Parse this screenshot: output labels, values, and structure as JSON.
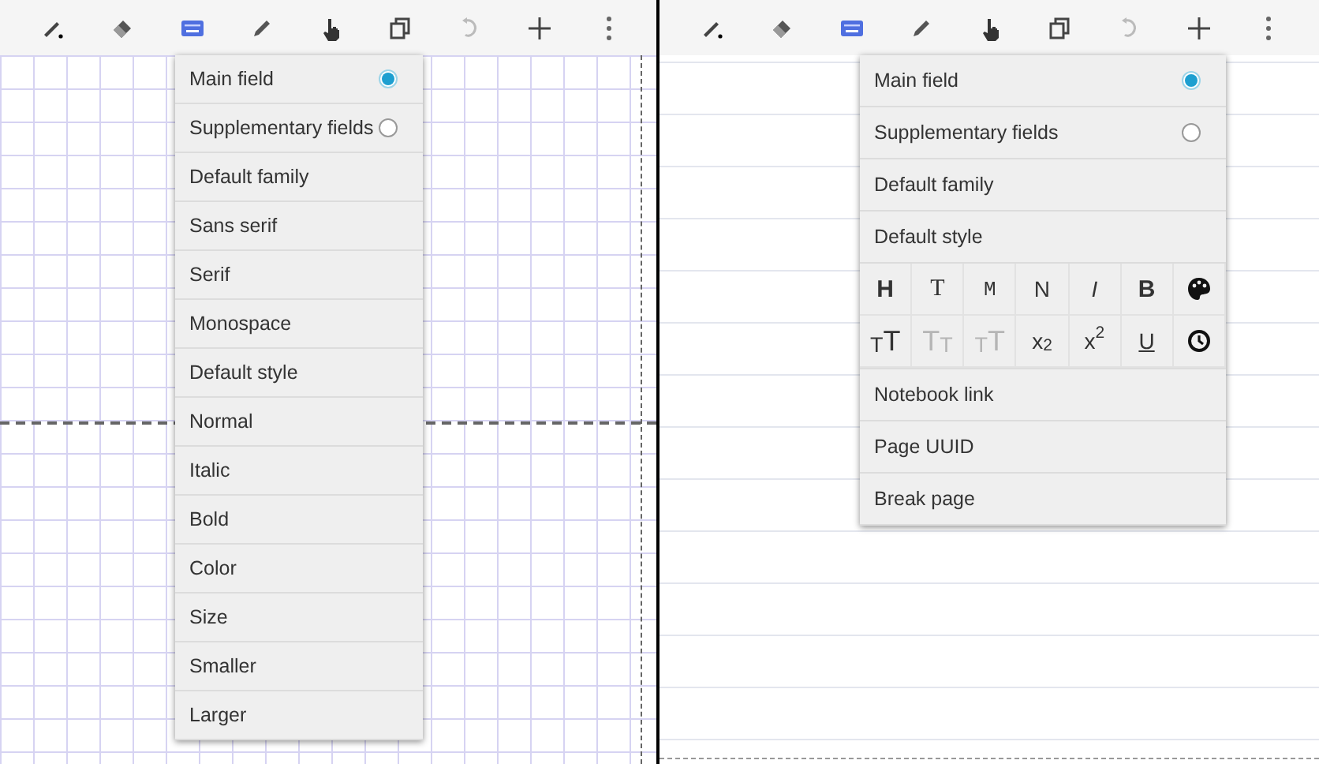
{
  "panels": [
    {
      "kind": "grid",
      "toolbar": [
        {
          "kind": "pen",
          "selected": false
        },
        {
          "kind": "eraser",
          "selected": false
        },
        {
          "kind": "keyboard",
          "selected": true
        },
        {
          "kind": "pencil",
          "selected": false
        },
        {
          "kind": "hand",
          "selected": false
        },
        {
          "kind": "copy",
          "selected": false
        },
        {
          "kind": "undo",
          "selected": false
        },
        {
          "kind": "plus",
          "selected": false
        },
        {
          "kind": "more",
          "selected": false
        }
      ],
      "menu": [
        {
          "kind": "radio",
          "label": "Main field",
          "selected": true
        },
        {
          "kind": "radio",
          "label": "Supplementary fields",
          "selected": false
        },
        {
          "kind": "item",
          "label": "Default family"
        },
        {
          "kind": "item",
          "label": "Sans serif"
        },
        {
          "kind": "item",
          "label": "Serif"
        },
        {
          "kind": "item",
          "label": "Monospace"
        },
        {
          "kind": "item",
          "label": "Default style"
        },
        {
          "kind": "item",
          "label": "Normal"
        },
        {
          "kind": "item",
          "label": "Italic"
        },
        {
          "kind": "item",
          "label": "Bold"
        },
        {
          "kind": "item",
          "label": "Color"
        },
        {
          "kind": "item",
          "label": "Size"
        },
        {
          "kind": "item",
          "label": "Smaller"
        },
        {
          "kind": "item",
          "label": "Larger"
        }
      ]
    },
    {
      "kind": "lined",
      "toolbar": [
        {
          "kind": "pen",
          "selected": false
        },
        {
          "kind": "eraser",
          "selected": false
        },
        {
          "kind": "keyboard",
          "selected": true
        },
        {
          "kind": "pencil",
          "selected": false
        },
        {
          "kind": "hand",
          "selected": false
        },
        {
          "kind": "copy",
          "selected": false
        },
        {
          "kind": "undo",
          "selected": false
        },
        {
          "kind": "plus",
          "selected": false
        },
        {
          "kind": "more",
          "selected": false
        }
      ],
      "menu": [
        {
          "kind": "radio",
          "label": "Main field",
          "selected": true
        },
        {
          "kind": "radio",
          "label": "Supplementary fields",
          "selected": false
        },
        {
          "kind": "item",
          "label": "Default family"
        },
        {
          "kind": "item",
          "label": "Default style"
        },
        {
          "kind": "grid",
          "cells": [
            {
              "kind": "heading",
              "label": "H",
              "disabled": false
            },
            {
              "kind": "serif",
              "label": "T",
              "disabled": false
            },
            {
              "kind": "mono",
              "label": "M",
              "disabled": false
            },
            {
              "kind": "normal",
              "label": "N",
              "disabled": false
            },
            {
              "kind": "italic",
              "label": "I",
              "disabled": false
            },
            {
              "kind": "bold",
              "label": "B",
              "disabled": false
            },
            {
              "kind": "palette"
            },
            {
              "kind": "big",
              "label": "$_{T}$T",
              "disabled": false
            },
            {
              "kind": "big",
              "label": "T$_{T}$",
              "disabled": true
            },
            {
              "kind": "big",
              "label": "$_{T}$T",
              "disabled": true
            },
            {
              "kind": "normal",
              "label": "x$_{2}$",
              "disabled": false
            },
            {
              "kind": "normal",
              "label": "x$^{2}$",
              "disabled": false
            },
            {
              "kind": "underline",
              "label": "U",
              "disabled": false
            },
            {
              "kind": "clock"
            }
          ]
        },
        {
          "kind": "item",
          "label": "Notebook link"
        },
        {
          "kind": "item",
          "label": "Page UUID"
        },
        {
          "kind": "item",
          "label": "Break page"
        }
      ]
    }
  ]
}
